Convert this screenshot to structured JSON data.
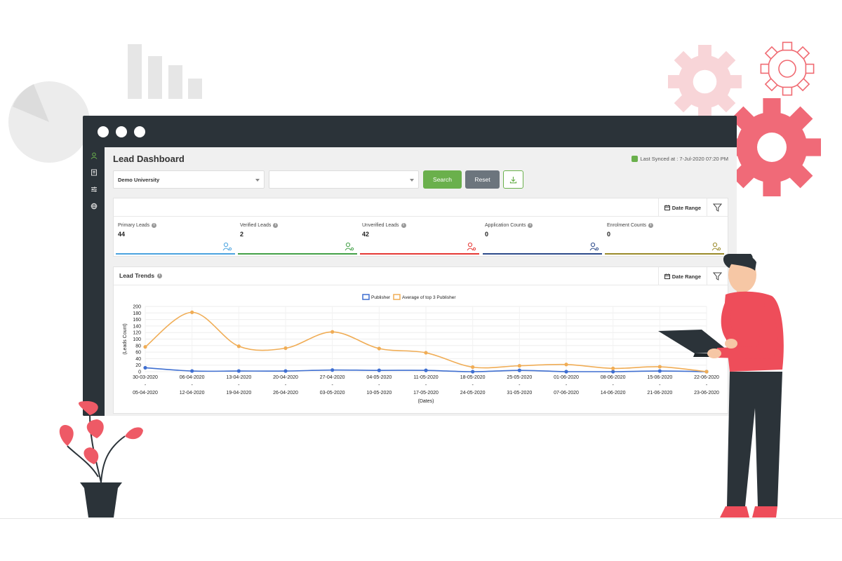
{
  "dashboard": {
    "title": "Lead Dashboard",
    "last_synced": "Last Synced at : 7-Jul-2020 07:20 PM"
  },
  "filters": {
    "university_value": "Demo University",
    "second_value": "",
    "search_label": "Search",
    "reset_label": "Reset",
    "download_icon": "download-icon"
  },
  "summary": {
    "date_range_label": "Date Range",
    "stats": [
      {
        "label": "Primary Leads",
        "value": "44",
        "color": "#4aa3df",
        "icon": "users-icon"
      },
      {
        "label": "Verified Leads",
        "value": "2",
        "color": "#43a047",
        "icon": "user-check-icon"
      },
      {
        "label": "Unverified Leads",
        "value": "42",
        "color": "#e53935",
        "icon": "user-x-icon"
      },
      {
        "label": "Application Counts",
        "value": "0",
        "color": "#2c4a8a",
        "icon": "document-icon"
      },
      {
        "label": "Enrolment Counts",
        "value": "0",
        "color": "#9a8a2a",
        "icon": "document-check-icon"
      }
    ]
  },
  "trends": {
    "title": "Lead Trends",
    "date_range_label": "Date Range"
  },
  "colors": {
    "accent_green": "#6ab04c",
    "reset_gray": "#6c757d",
    "publisher_blue": "#3f6fd1",
    "average_orange": "#f0ad56",
    "window_dark": "#2b3339"
  },
  "chart_data": {
    "type": "line",
    "title": "",
    "xlabel": "(Dates)",
    "ylabel": "(Leads Count)",
    "ylim": [
      0,
      200
    ],
    "yticks": [
      0,
      20,
      40,
      60,
      80,
      100,
      120,
      140,
      160,
      180,
      200
    ],
    "grid": true,
    "legend_position": "top-center",
    "categories": [
      [
        "30-03-2020",
        "-",
        "05-04-2020"
      ],
      [
        "06-04-2020",
        "-",
        "12-04-2020"
      ],
      [
        "13-04-2020",
        "-",
        "19-04-2020"
      ],
      [
        "20-04-2020",
        "-",
        "26-04-2020"
      ],
      [
        "27-04-2020",
        "-",
        "03-05-2020"
      ],
      [
        "04-05-2020",
        "-",
        "10-05-2020"
      ],
      [
        "11-05-2020",
        "-",
        "17-05-2020"
      ],
      [
        "18-05-2020",
        "-",
        "24-05-2020"
      ],
      [
        "25-05-2020",
        "-",
        "31-05-2020"
      ],
      [
        "01-06-2020",
        "-",
        "07-06-2020"
      ],
      [
        "08-06-2020",
        "-",
        "14-06-2020"
      ],
      [
        "15-06-2020",
        "-",
        "21-06-2020"
      ],
      [
        "22-06-2020",
        "-",
        "23-06-2020"
      ]
    ],
    "series": [
      {
        "name": "Publisher",
        "color": "#3f6fd1",
        "values": [
          12,
          2,
          2,
          2,
          5,
          4,
          4,
          0,
          4,
          0,
          0,
          2,
          0
        ]
      },
      {
        "name": "Average of top 3 Publisher",
        "color": "#f0ad56",
        "values": [
          76,
          182,
          78,
          72,
          122,
          71,
          58,
          14,
          18,
          22,
          10,
          15,
          0
        ]
      }
    ]
  }
}
